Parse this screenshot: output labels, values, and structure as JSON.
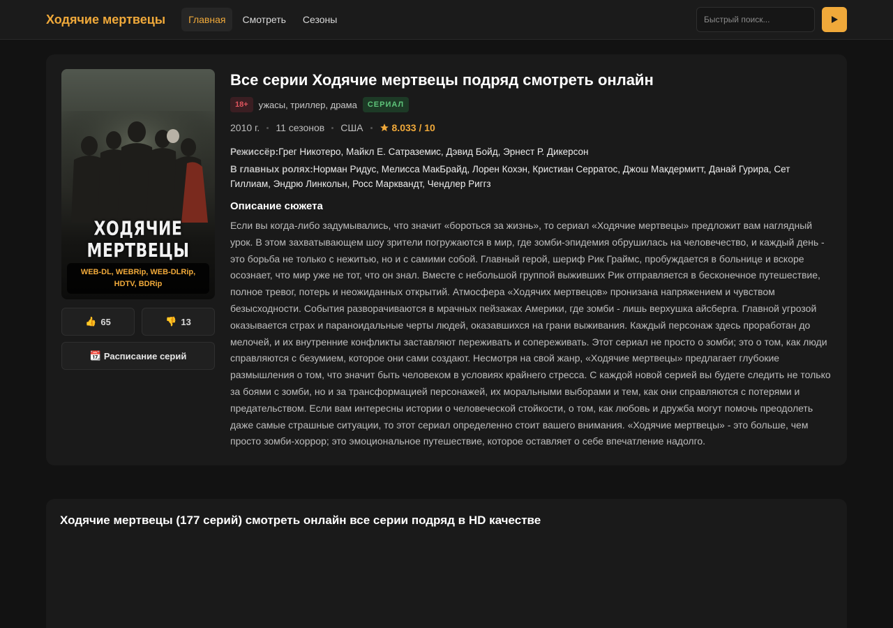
{
  "header": {
    "logo": "Ходячие мертвецы",
    "nav": [
      {
        "label": "Главная",
        "active": true
      },
      {
        "label": "Смотреть",
        "active": false
      },
      {
        "label": "Сезоны",
        "active": false
      }
    ],
    "search_placeholder": "Быстрый поиск..."
  },
  "poster": {
    "title": "ХОДЯЧИЕ МЕРТВЕЦЫ",
    "quality": "WEB-DL, WEBRip, WEB-DLRip, HDTV, BDRip"
  },
  "votes": {
    "likes": "65",
    "dislikes": "13"
  },
  "schedule_label": "Расписание серий",
  "info": {
    "title": "Все серии Ходячие мертвецы подряд смотреть онлайн",
    "age": "18+",
    "genres": "ужасы, триллер, драма",
    "type": "СЕРИАЛ",
    "year": "2010 г.",
    "seasons": "11 сезонов",
    "country": "США",
    "rating": "8.033 / 10",
    "director_label": "Режиссёр:",
    "directors": "Грег Никотеро, Майкл Е. Сатраземис, Дэвид Бойд, Эрнест Р. Дикерсон",
    "cast_label": "В главных ролях:",
    "cast": "Норман Ридус, Мелисса МакБрайд, Лорен Кохэн, Кристиан Серратос, Джош Макдермитт, Данай Гурира, Сет Гиллиам, Эндрю Линкольн, Росс Марквандт, Чендлер Риггз",
    "desc_title": "Описание сюжета",
    "description": "Если вы когда-либо задумывались, что значит «бороться за жизнь», то сериал «Ходячие мертвецы» предложит вам наглядный урок. В этом захватывающем шоу зрители погружаются в мир, где зомби-эпидемия обрушилась на человечество, и каждый день - это борьба не только с нежитью, но и с самими собой. Главный герой, шериф Рик Граймс, пробуждается в больнице и вскоре осознает, что мир уже не тот, что он знал. Вместе с небольшой группой выживших Рик отправляется в бесконечное путешествие, полное тревог, потерь и неожиданных открытий. Атмосфера «Ходячих мертвецов» пронизана напряжением и чувством безысходности. События разворачиваются в мрачных пейзажах Америки, где зомби - лишь верхушка айсберга. Главной угрозой оказывается страх и параноидальные черты людей, оказавшихся на грани выживания. Каждый персонаж здесь проработан до мелочей, и их внутренние конфликты заставляют переживать и сопереживать. Этот сериал не просто о зомби; это о том, как люди справляются с безумием, которое они сами создают. Несмотря на свой жанр, «Ходячие мертвецы» предлагает глубокие размышления о том, что значит быть человеком в условиях крайнего стресса. С каждой новой серией вы будете следить не только за боями с зомби, но и за трансформацией персонажей, их моральными выборами и тем, как они справляются с потерями и предательством. Если вам интересны истории о человеческой стойкости, о том, как любовь и дружба могут помочь преодолеть даже самые страшные ситуации, то этот сериал определенно стоит вашего внимания. «Ходячие мертвецы» - это больше, чем просто зомби-хоррор; это эмоциональное путешествие, которое оставляет о себе впечатление надолго."
  },
  "episodes": {
    "title": "Ходячие мертвецы (177 серий) смотреть онлайн все серии подряд в HD качестве"
  },
  "colors": {
    "accent": "#f0a93a",
    "background": "#121212",
    "card": "#1a1a1a"
  }
}
